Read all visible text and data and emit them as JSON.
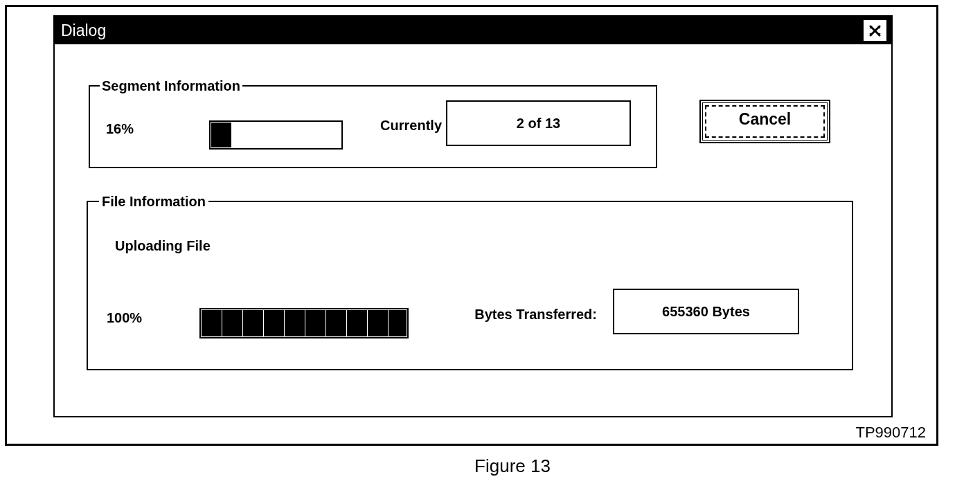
{
  "window": {
    "title": "Dialog"
  },
  "segment_information": {
    "title": "Segment Information",
    "percent": "16%",
    "progress": {
      "level": 0.16
    },
    "current_label": "Currently",
    "current_value": "2 of 13"
  },
  "cancel_button": {
    "label": "Cancel",
    "focused": true
  },
  "file_information": {
    "title": "File Information",
    "status": "Uploading File",
    "percent": "100%",
    "progress": {
      "level": 1
    },
    "bytes_label": "Bytes Transferred:",
    "bytes_value": "655360 Bytes"
  },
  "figure_code": "TP990712",
  "caption": "Figure 13"
}
